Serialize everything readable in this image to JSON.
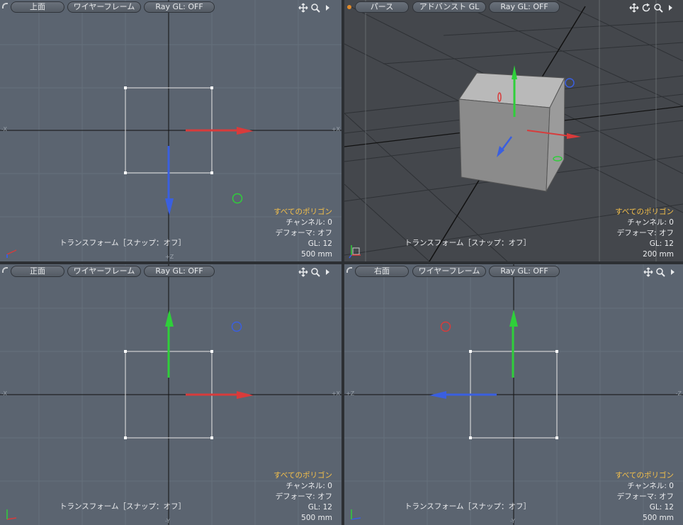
{
  "viewports": [
    {
      "id": "top",
      "view_label": "上面",
      "shading_label": "ワイヤーフレーム",
      "raygl_label": "Ray GL: OFF",
      "selection": "すべてのポリゴン",
      "channels": "チャンネル: 0",
      "deformers": "デフォーマ: オフ",
      "gl": "GL: 12",
      "scale": "500 mm",
      "status": "トランスフォーム［スナップ：オフ］",
      "axis_left": "-X",
      "axis_right": "+X",
      "axis_bottom": "+Z"
    },
    {
      "id": "perspective",
      "view_label": "パース",
      "shading_label": "アドバンスト GL",
      "raygl_label": "Ray GL: OFF",
      "selection": "すべてのポリゴン",
      "channels": "チャンネル: 0",
      "deformers": "デフォーマ: オフ",
      "gl": "GL: 12",
      "scale": "200 mm",
      "status": "トランスフォーム［スナップ：オフ］"
    },
    {
      "id": "front",
      "view_label": "正面",
      "shading_label": "ワイヤーフレーム",
      "raygl_label": "Ray GL: OFF",
      "selection": "すべてのポリゴン",
      "channels": "チャンネル: 0",
      "deformers": "デフォーマ: オフ",
      "gl": "GL: 12",
      "scale": "500 mm",
      "status": "トランスフォーム［スナップ：オフ］",
      "axis_left": "-X",
      "axis_right": "+X",
      "axis_bottom": "-Y"
    },
    {
      "id": "right",
      "view_label": "右面",
      "shading_label": "ワイヤーフレーム",
      "raygl_label": "Ray GL: OFF",
      "selection": "すべてのポリゴン",
      "channels": "チャンネル: 0",
      "deformers": "デフォーマ: オフ",
      "gl": "GL: 12",
      "scale": "500 mm",
      "status": "トランスフォーム［スナップ：オフ］",
      "axis_left": "+Z",
      "axis_right": "-Z",
      "axis_bottom": "-Y"
    }
  ],
  "icons": {
    "pan": "pan-icon",
    "rotate": "rotate-icon",
    "zoom": "zoom-icon",
    "more": "expand-arrow-icon"
  },
  "colors": {
    "x_axis": "#d83b3b",
    "y_axis": "#2fcf3a",
    "z_axis": "#3a5fe0",
    "selection_text": "#f5c04a",
    "viewport_bg": "#5b6470"
  }
}
